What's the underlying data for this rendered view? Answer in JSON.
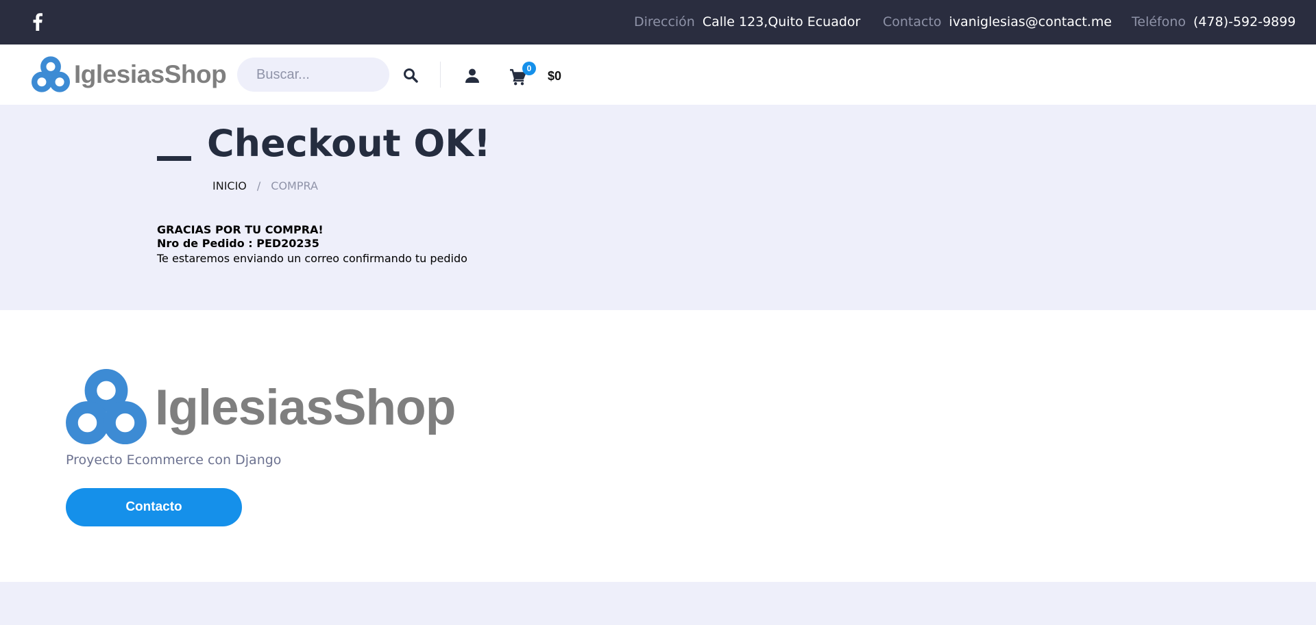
{
  "topbar": {
    "social": {
      "icon": "facebook-icon"
    },
    "address": {
      "label": "Dirección",
      "value": "Calle 123,Quito Ecuador"
    },
    "contact": {
      "label": "Contacto",
      "value": "ivaniglesias@contact.me"
    },
    "phone": {
      "label": "Teléfono",
      "value": "(478)-592-9899"
    }
  },
  "header": {
    "brand": "IglesiasShop",
    "search": {
      "placeholder": "Buscar...",
      "value": ""
    },
    "cart": {
      "count": "0",
      "total": "$0"
    }
  },
  "content": {
    "title": "Checkout OK!",
    "breadcrumb": {
      "home": "INICIO",
      "separator": "/",
      "current": "COMPRA"
    },
    "thanks": "GRACIAS POR TU COMPRA!",
    "order_number": "Nro de Pedido : PED20235",
    "email_notice": "Te estaremos enviando un correo confirmando tu pedido"
  },
  "footer": {
    "brand": "IglesiasShop",
    "tagline": "Proyecto Ecommerce con Django",
    "contact_button": "Contacto"
  },
  "colors": {
    "topbar_bg": "#2a2d3f",
    "accent": "#1590ea",
    "band_bg": "#eeeffa",
    "title": "#252d3f",
    "logo_blue": "#3d8bd4",
    "logo_gray": "#7f7f7f"
  }
}
